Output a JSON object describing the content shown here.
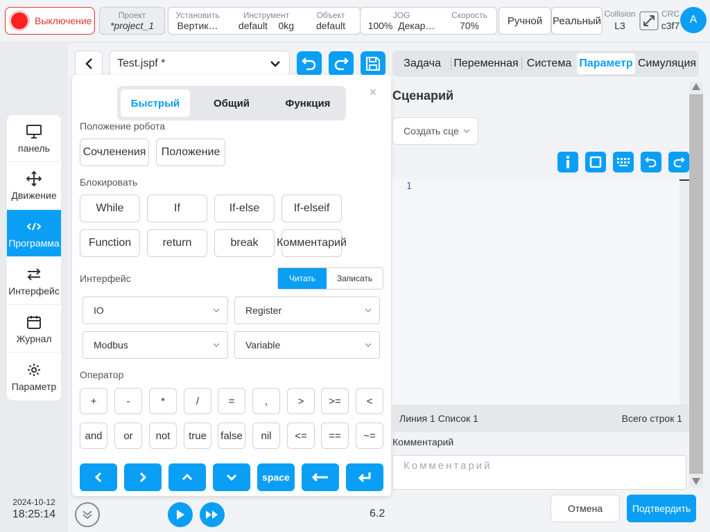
{
  "topbar": {
    "power_label": "Выключение",
    "project": {
      "key": "Проект",
      "value": "*project_1"
    },
    "install": {
      "key": "Установить",
      "value": "Вертик…"
    },
    "tool": {
      "key": "Инструмент",
      "value": "default",
      "mass": "0kg"
    },
    "object": {
      "key": "Объект",
      "value": "default"
    },
    "jog": {
      "key": "JOG",
      "percent": "100%",
      "frame": "Декар…"
    },
    "speed": {
      "key": "Скорость",
      "value": "70%"
    },
    "mode": "Ручной",
    "real": "Реальный",
    "collision": {
      "key": "Collision",
      "value": "L3"
    },
    "crc": {
      "key": "CRC",
      "value": "c3f7"
    },
    "avatar": "A"
  },
  "nav": {
    "items": [
      {
        "label": "панель",
        "icon": "monitor-icon"
      },
      {
        "label": "Движение",
        "icon": "move-icon"
      },
      {
        "label": "Программа",
        "icon": "code-icon"
      },
      {
        "label": "Интерфейс",
        "icon": "swap-icon"
      },
      {
        "label": "Журнал",
        "icon": "calendar-icon"
      },
      {
        "label": "Параметр",
        "icon": "gear-icon"
      }
    ],
    "active_index": 2,
    "date": "2024-10-12",
    "time": "18:25:14"
  },
  "file": {
    "name": "Test.jspf *"
  },
  "tabs": [
    {
      "label": "Задача"
    },
    {
      "label": "Переменная"
    },
    {
      "label": "Система"
    },
    {
      "label": "Параметр"
    },
    {
      "label": "Симуляция"
    }
  ],
  "quick": {
    "segments": [
      "Быстрый",
      "Общий",
      "Функция"
    ],
    "robot_pos_label": "Положение робота",
    "robot_pos_buttons": [
      "Сочленения",
      "Положение"
    ],
    "block_label": "Блокировать",
    "block_buttons": [
      "While",
      "If",
      "If-else",
      "If-elseif",
      "Function",
      "return",
      "break",
      "Комментарий"
    ],
    "interface_label": "Интерфейс",
    "read_label": "Читать",
    "write_label": "Записать",
    "dropdowns": [
      "IO",
      "Register",
      "Modbus",
      "Variable"
    ],
    "operator_label": "Оператор",
    "operators_row1": [
      "+",
      "-",
      "*",
      "/",
      "=",
      ",",
      ">",
      ">=",
      "<"
    ],
    "operators_row2": [
      "and",
      "or",
      "not",
      "true",
      "false",
      "nil",
      "<=",
      "==",
      "~="
    ],
    "space_label": "space"
  },
  "scenario": {
    "title": "Сценарий",
    "create_placeholder": "Создать сценарий",
    "line_number": "1",
    "status_left": "Линия 1 Список 1",
    "status_right": "Всего строк 1",
    "comment_label": "Комментарий",
    "comment_placeholder": "Комментарий",
    "cancel": "Отмена",
    "confirm": "Подтвердить"
  },
  "footer": {
    "version": "6.2"
  },
  "colors": {
    "accent": "#0a9ff5",
    "danger": "#e23030"
  }
}
